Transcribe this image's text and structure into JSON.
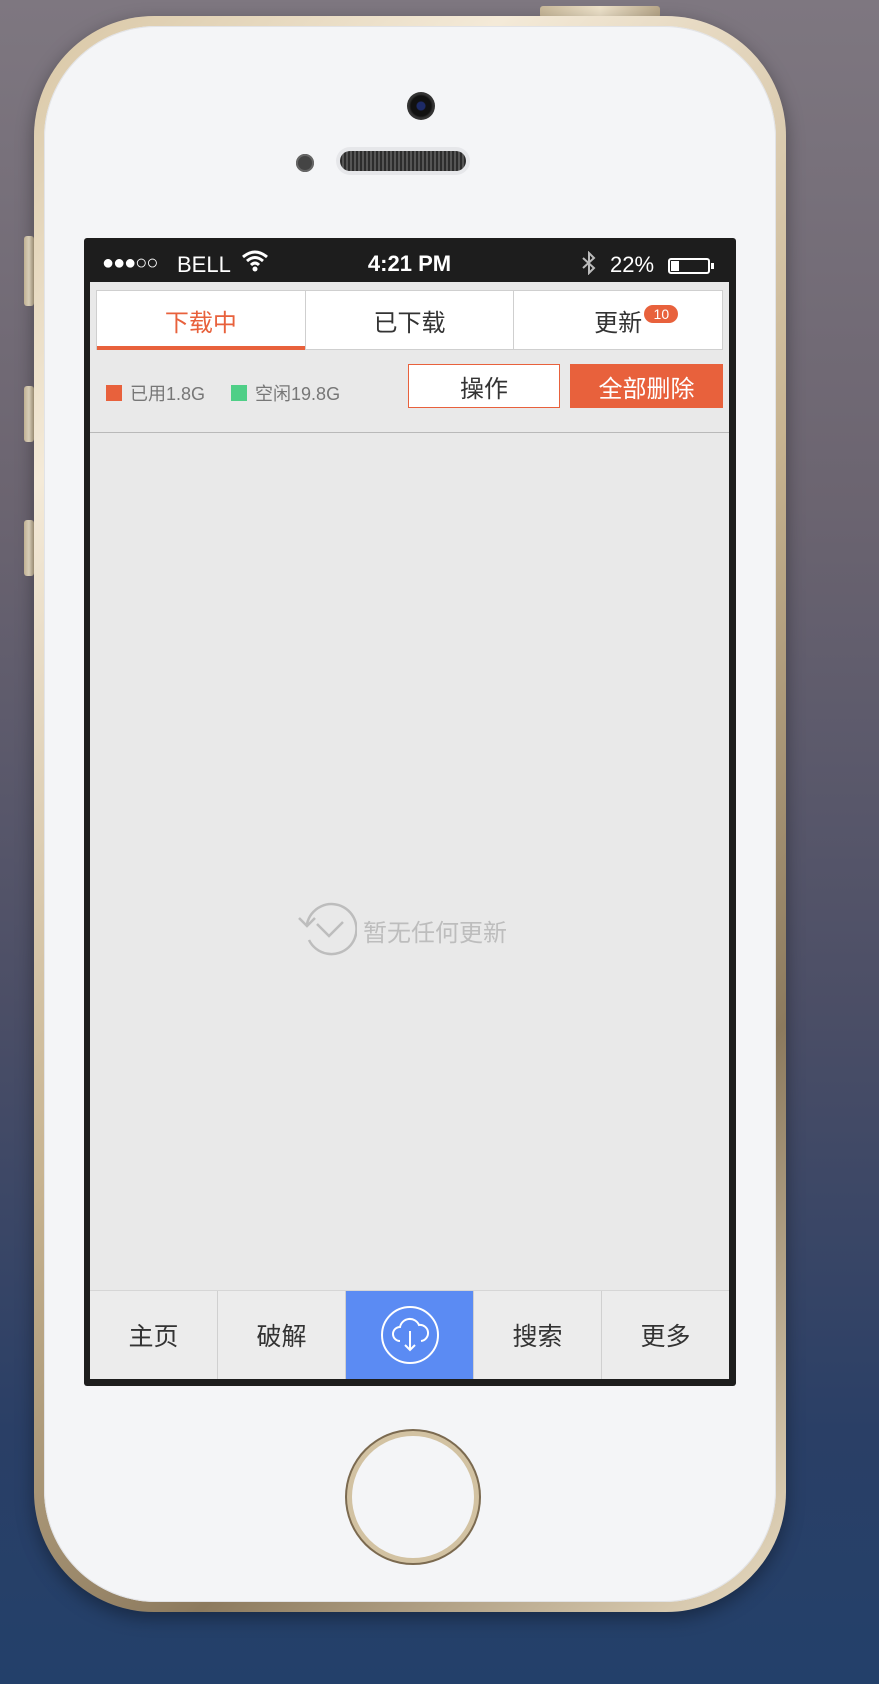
{
  "status_bar": {
    "signal": "●●●○○",
    "carrier": "BELL",
    "time": "4:21 PM",
    "battery_percent": "22%",
    "battery_level": 0.22
  },
  "tabs": [
    {
      "label": "下载中",
      "active": true
    },
    {
      "label": "已下载",
      "active": false
    },
    {
      "label": "更新",
      "active": false,
      "badge": "10"
    }
  ],
  "storage": {
    "used_label": "已用1.8G",
    "free_label": "空闲19.8G",
    "used_color": "#e8613c",
    "free_color": "#4fcf87"
  },
  "actions": {
    "operate_label": "操作",
    "delete_all_label": "全部删除"
  },
  "empty_state": {
    "icon": "refresh-clock-icon",
    "text": "暂无任何更新"
  },
  "bottom_nav": [
    {
      "label": "主页"
    },
    {
      "label": "破解"
    },
    {
      "label": "",
      "icon": "cloud-download-icon",
      "active": true
    },
    {
      "label": "搜索"
    },
    {
      "label": "更多"
    }
  ],
  "colors": {
    "accent": "#e8613c",
    "nav_active": "#5b8bf3"
  }
}
